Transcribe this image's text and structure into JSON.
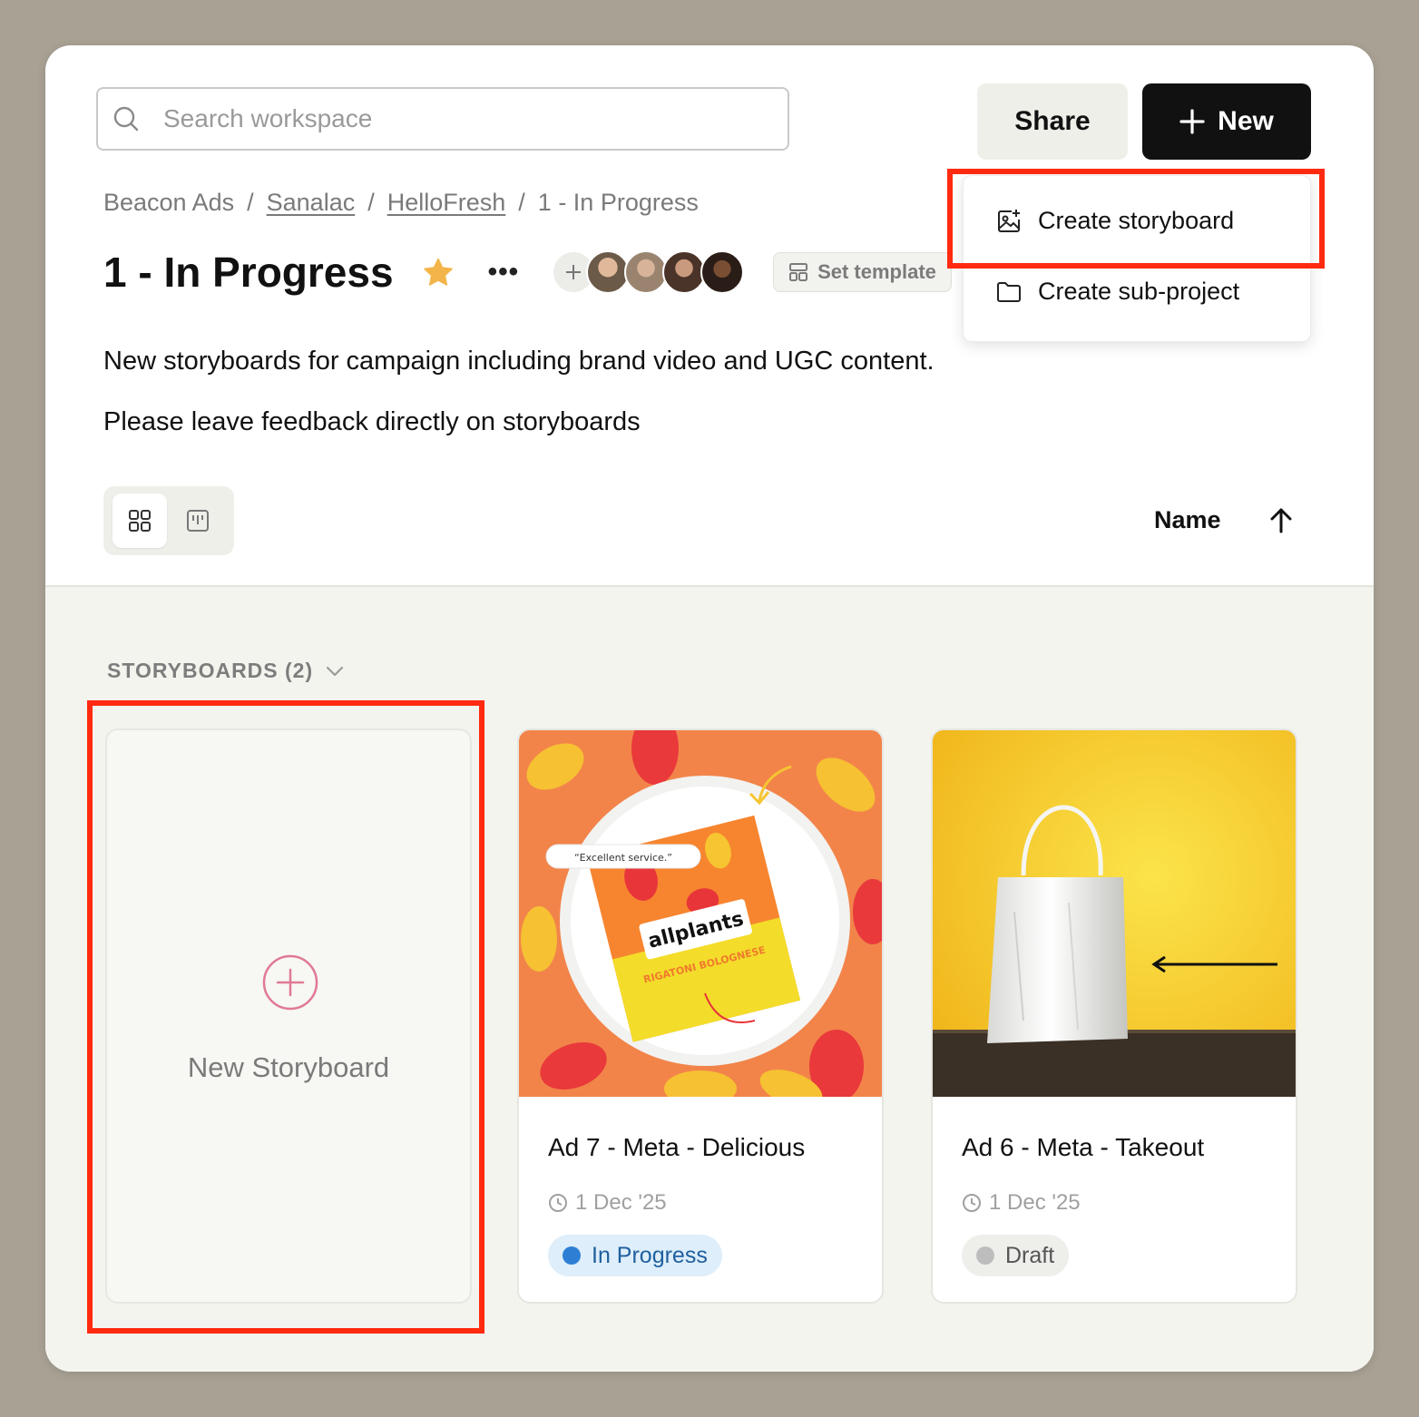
{
  "search": {
    "placeholder": "Search workspace",
    "value": ""
  },
  "header": {
    "share_label": "Share",
    "new_label": "New"
  },
  "menu": {
    "items": [
      {
        "label": "Create storyboard",
        "icon": "image-plus-icon"
      },
      {
        "label": "Create sub-project",
        "icon": "folder-icon"
      }
    ]
  },
  "breadcrumb": {
    "items": [
      "Beacon Ads",
      "Sanalac",
      "HelloFresh",
      "1 - In Progress"
    ],
    "separator": "/"
  },
  "page": {
    "title": "1 - In Progress",
    "set_template_label": "Set template",
    "more_label": "•••",
    "description": [
      "New storyboards for campaign including brand video and UGC content.",
      "Please leave feedback directly on storyboards"
    ]
  },
  "members": {
    "count": 4
  },
  "toolbar": {
    "sort_label": "Name",
    "sort_direction": "ascending"
  },
  "section": {
    "label": "STORYBOARDS (2)"
  },
  "new_card": {
    "label": "New Storyboard"
  },
  "cards": [
    {
      "title": "Ad 7 - Meta - Delicious",
      "date": "1 Dec '25",
      "status": "In Progress",
      "status_color": "#2e7fd4",
      "status_bg": "#deeefa",
      "thumb_quote": "“Excellent service.”",
      "thumb_brand": "allplants",
      "thumb_product": "RIGATONI BOLOGNESE"
    },
    {
      "title": "Ad 6 - Meta - Takeout",
      "date": "1 Dec '25",
      "status": "Draft",
      "status_color": "#bdbdbd",
      "status_bg": "#eeeeeb"
    }
  ],
  "colors": {
    "highlight": "#ff2a0f",
    "accent_star": "#f3b54a",
    "new_button_bg": "#111111",
    "new_plus": "#e07a94"
  }
}
